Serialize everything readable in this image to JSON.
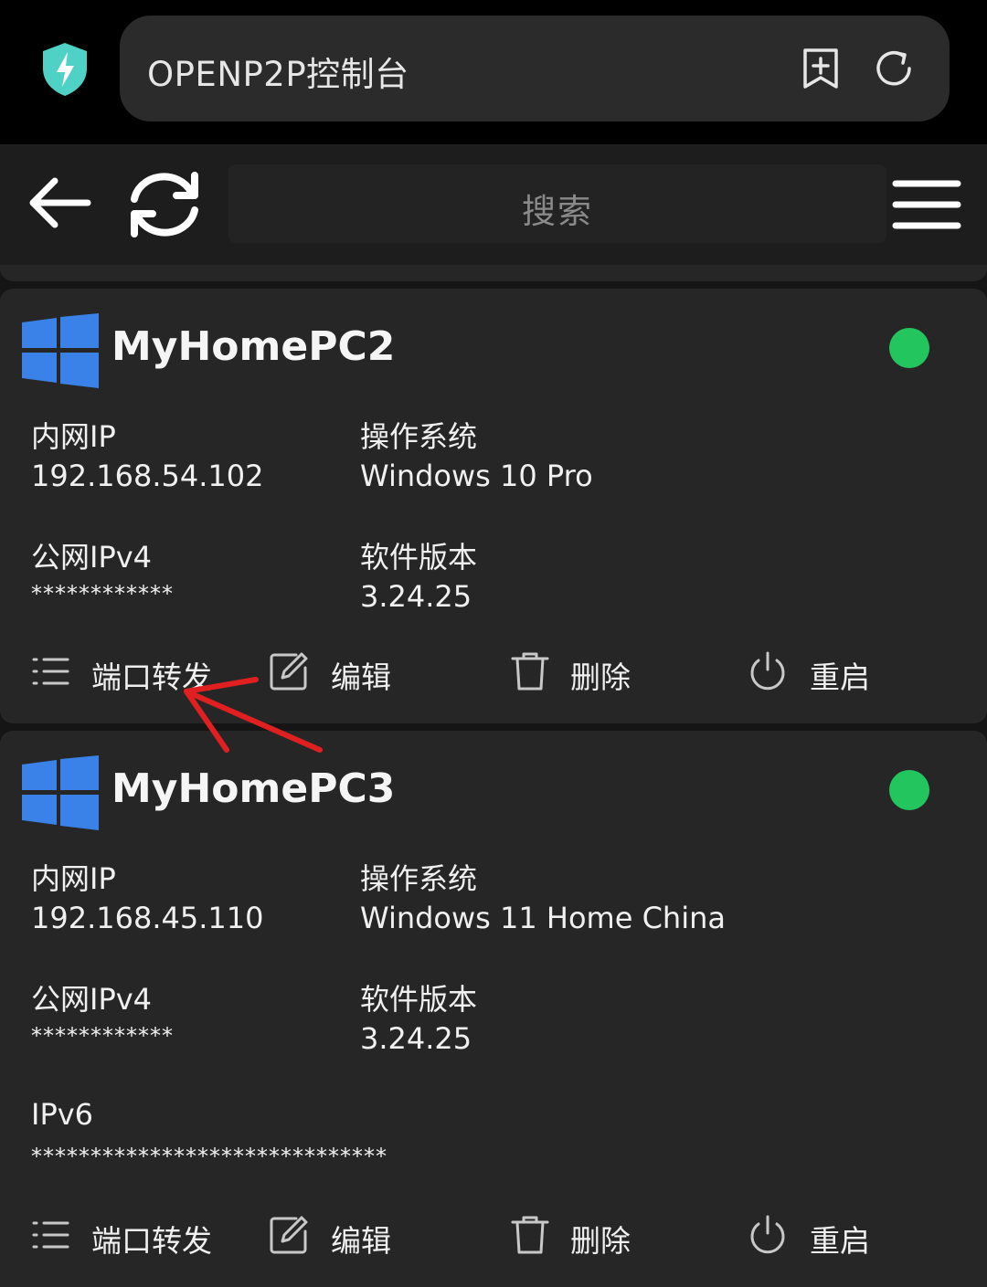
{
  "browser": {
    "url_title": "OPENP2P控制台"
  },
  "toolbar": {
    "search_placeholder": "搜索"
  },
  "colors": {
    "online": "#22c55e",
    "windows_blue": "#3b82e8",
    "annotation": "#e02020"
  },
  "devices": [
    {
      "name": "MyHomePC2",
      "online": true,
      "lan_ip_label": "内网IP",
      "lan_ip": "192.168.54.102",
      "os_label": "操作系统",
      "os": "Windows 10 Pro",
      "public_ipv4_label": "公网IPv4",
      "public_ipv4": "************",
      "version_label": "软件版本",
      "version": "3.24.25",
      "actions": {
        "forward": "端口转发",
        "edit": "编辑",
        "delete": "删除",
        "restart": "重启"
      }
    },
    {
      "name": "MyHomePC3",
      "online": true,
      "lan_ip_label": "内网IP",
      "lan_ip": "192.168.45.110",
      "os_label": "操作系统",
      "os": "Windows 11 Home China",
      "public_ipv4_label": "公网IPv4",
      "public_ipv4": "************",
      "version_label": "软件版本",
      "version": "3.24.25",
      "ipv6_label": "IPv6",
      "ipv6": "******************************",
      "actions": {
        "forward": "端口转发",
        "edit": "编辑",
        "delete": "删除",
        "restart": "重启"
      }
    }
  ]
}
